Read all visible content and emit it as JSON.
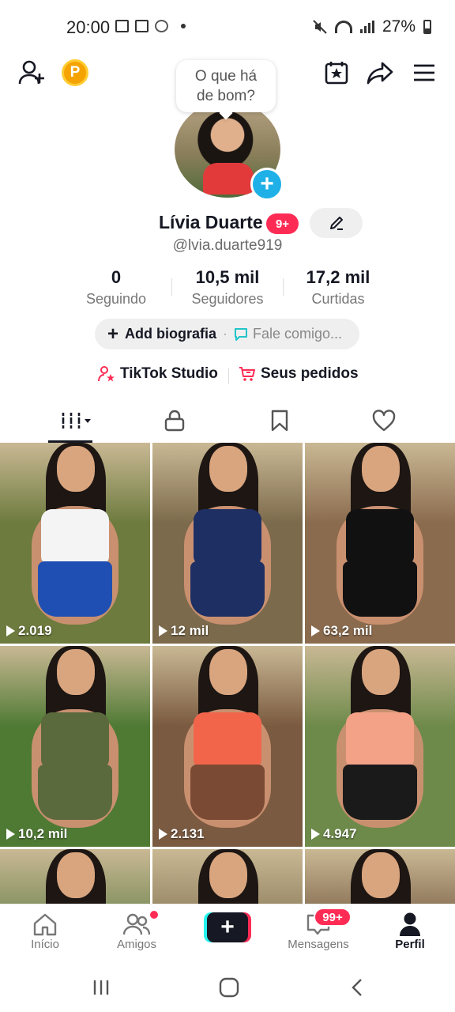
{
  "status_bar": {
    "time": "20:00",
    "battery": "27%"
  },
  "header": {
    "coin_letter": "P"
  },
  "bubble": {
    "line1": "O que há",
    "line2": "de bom?"
  },
  "profile": {
    "name": "Lívia Duarte",
    "name_badge": "9+",
    "handle": "@lvia.duarte919"
  },
  "stats": [
    {
      "value": "0",
      "label": "Seguindo"
    },
    {
      "value": "10,5 mil",
      "label": "Seguidores"
    },
    {
      "value": "17,2 mil",
      "label": "Curtidas"
    }
  ],
  "bio": {
    "add_label": "Add biografia",
    "message_label": "Fale comigo..."
  },
  "links": {
    "studio": "TikTok Studio",
    "orders": "Seus pedidos"
  },
  "videos": [
    {
      "views": "2.019",
      "top_color": "#f4f4f4",
      "bottom_color": "#1f4fb3",
      "bg": "#6d7b3e"
    },
    {
      "views": "12 mil",
      "top_color": "#1e2f63",
      "bottom_color": "#1e2f63",
      "bg": "#7c6a4c"
    },
    {
      "views": "63,2 mil",
      "top_color": "#111111",
      "bottom_color": "#111111",
      "bg": "#8b6b4e"
    },
    {
      "views": "10,2 mil",
      "top_color": "#5b6a3d",
      "bottom_color": "#5b6a3d",
      "bg": "#4f7a34"
    },
    {
      "views": "2.131",
      "top_color": "#f2654b",
      "bottom_color": "#7b4a34",
      "bg": "#7a5a40"
    },
    {
      "views": "4.947",
      "top_color": "#f3a287",
      "bottom_color": "#1a1a1a",
      "bg": "#6e8a4a"
    },
    {
      "views": "",
      "top_color": "#ffffff",
      "bottom_color": "#ffffff",
      "bg": "#6f8550"
    },
    {
      "views": "",
      "top_color": "#e6c3a7",
      "bottom_color": "#e6c3a7",
      "bg": "#8a7a58"
    },
    {
      "views": "",
      "top_color": "#d9c3ee",
      "bottom_color": "#d9c3ee",
      "bg": "#7a5f46"
    }
  ],
  "nav": {
    "home": "Início",
    "friends": "Amigos",
    "messages": "Mensagens",
    "messages_badge": "99+",
    "profile": "Perfil"
  },
  "colors": {
    "accent": "#fe2c55",
    "cyan": "#25f4ee",
    "plus_blue": "#1fb0e8"
  }
}
